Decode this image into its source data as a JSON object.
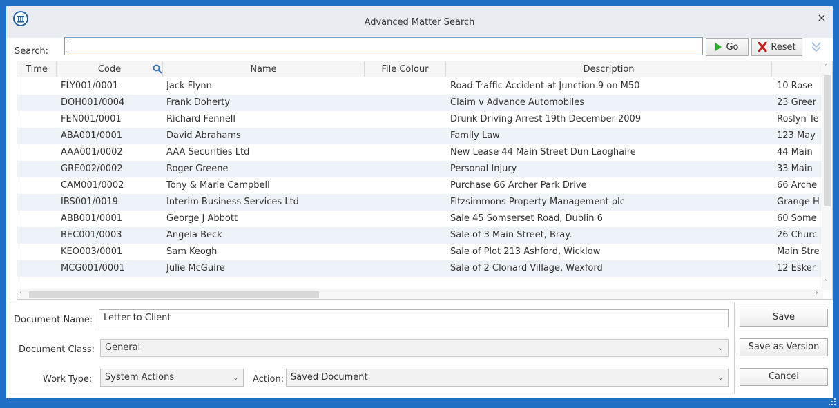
{
  "window": {
    "title": "Advanced Matter Search",
    "close_glyph": "×"
  },
  "search": {
    "label": "Search:",
    "value": "",
    "go_label": "Go",
    "reset_label": "Reset"
  },
  "grid": {
    "columns": [
      "Time",
      "Code",
      "Name",
      "File Colour",
      "Description",
      ""
    ],
    "rows": [
      {
        "time": "",
        "code": "FLY001/0001",
        "name": "Jack Flynn",
        "colour": "",
        "description": "Road Traffic Accident at Junction 9 on M50",
        "extra": "10 Rose"
      },
      {
        "time": "",
        "code": "DOH001/0004",
        "name": "Frank Doherty",
        "colour": "",
        "description": "Claim v Advance Automobiles",
        "extra": "23 Greer"
      },
      {
        "time": "",
        "code": "FEN001/0001",
        "name": "Richard Fennell",
        "colour": "",
        "description": "Drunk Driving Arrest 19th December 2009",
        "extra": "Roslyn Te"
      },
      {
        "time": "",
        "code": "ABA001/0001",
        "name": "David Abrahams",
        "colour": "",
        "description": "Family Law",
        "extra": "123 May"
      },
      {
        "time": "",
        "code": "AAA001/0002",
        "name": "AAA Securities Ltd",
        "colour": "",
        "description": "New Lease 44 Main Street Dun Laoghaire",
        "extra": "44 Main"
      },
      {
        "time": "",
        "code": "GRE002/0002",
        "name": "Roger Greene",
        "colour": "",
        "description": "Personal Injury",
        "extra": "33 Main"
      },
      {
        "time": "",
        "code": "CAM001/0002",
        "name": "Tony & Marie Campbell",
        "colour": "",
        "description": "Purchase 66 Archer Park Drive",
        "extra": "66 Arche"
      },
      {
        "time": "",
        "code": "IBS001/0019",
        "name": "Interim Business Services Ltd",
        "colour": "",
        "description": "Fitzsimmons Property Management plc",
        "extra": "Grange H"
      },
      {
        "time": "",
        "code": "ABB001/0001",
        "name": "George J Abbott",
        "colour": "",
        "description": "Sale 45 Somserset Road, Dublin 6",
        "extra": "60 Some"
      },
      {
        "time": "",
        "code": "BEC001/0003",
        "name": "Angela Beck",
        "colour": "",
        "description": "Sale of 3 Main Street, Bray.",
        "extra": "26 Churc"
      },
      {
        "time": "",
        "code": "KEO003/0001",
        "name": "Sam Keogh",
        "colour": "",
        "description": "Sale of Plot 213 Ashford, Wicklow",
        "extra": "Main Stre"
      },
      {
        "time": "",
        "code": "MCG001/0001",
        "name": "Julie McGuire",
        "colour": "",
        "description": "Sale of 2 Clonard Village, Wexford",
        "extra": "12 Esker"
      }
    ]
  },
  "form": {
    "document_name_label": "Document Name:",
    "document_name_value": "Letter to Client",
    "document_class_label": "Document Class:",
    "document_class_value": "General",
    "work_type_label": "Work Type:",
    "work_type_value": "System Actions",
    "action_label": "Action:",
    "action_value": "Saved Document"
  },
  "buttons": {
    "save": "Save",
    "save_as_version": "Save as Version",
    "cancel": "Cancel"
  },
  "colors": {
    "accent": "#1f6fc7",
    "row_alt": "#eef3fa",
    "go_green": "#2ea82e",
    "reset_red": "#c8201e"
  }
}
